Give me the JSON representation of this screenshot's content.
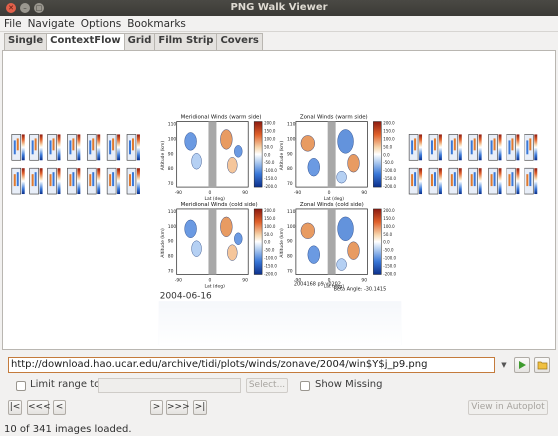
{
  "window": {
    "title": "PNG Walk Viewer"
  },
  "menu": {
    "items": [
      "File",
      "Navigate",
      "Options",
      "Bookmarks"
    ]
  },
  "tabs": [
    "Single",
    "ContextFlow",
    "Grid",
    "Film Strip",
    "Covers"
  ],
  "viewer": {
    "caption": "2004-06-16",
    "panels": [
      {
        "title": "Meridional Winds (warm side)",
        "xlabel": "Lat (deg)",
        "ylabel": "Altitude (km)",
        "cb_ticks": [
          "200.0",
          "150.0",
          "100.0",
          "50.0",
          "0.0",
          "-50.0",
          "-100.0",
          "-150.0",
          "-200.0"
        ]
      },
      {
        "title": "Zonal Winds (warm side)",
        "xlabel": "Lat (deg)",
        "ylabel": "Altitude (km)",
        "cb_ticks": [
          "200.0",
          "150.0",
          "100.0",
          "50.0",
          "0.0",
          "-50.0",
          "-100.0",
          "-150.0",
          "-200.0"
        ]
      },
      {
        "title": "Meridional Winds (cold side)",
        "xlabel": "Lat (deg)",
        "ylabel": "Altitude (km)",
        "cb_ticks": [
          "200.0",
          "150.0",
          "100.0",
          "50.0",
          "0.0",
          "-50.0",
          "-100.0",
          "-150.0",
          "-200.0"
        ]
      },
      {
        "title": "Zonal Winds (cold side)",
        "xlabel": "Lat (deg)",
        "ylabel": "Altitude (km)",
        "cb_ticks": [
          "200.0",
          "150.0",
          "100.0",
          "50.0",
          "0.0",
          "-50.0",
          "-100.0",
          "-150.0",
          "-200.0"
        ]
      }
    ],
    "y_ticks": [
      "110",
      "100",
      "90",
      "80",
      "70"
    ],
    "x_ticks": [
      "-90",
      "0",
      "90"
    ],
    "footer_left": "2004168 p9 v0202",
    "footer_right": "Beta Angle: -30.1415"
  },
  "url": {
    "value": "http://download.hao.ucar.edu/archive/tidi/plots/winds/zonave/2004/win$Y$j_p9.png"
  },
  "range": {
    "limit_label": "Limit range to:",
    "select_label": "Select...",
    "show_missing_label": "Show Missing"
  },
  "nav": {
    "first": "|<",
    "prev_page": "<<<",
    "prev": "<",
    "next": ">",
    "next_page": ">>>",
    "last": ">|",
    "autoplot": "View in Autoplot"
  },
  "status": {
    "text": "10 of 341 images loaded."
  },
  "colors": {
    "accent": "#c47b3c",
    "warm": "#e07a2e",
    "cool": "#2f6fd0"
  }
}
